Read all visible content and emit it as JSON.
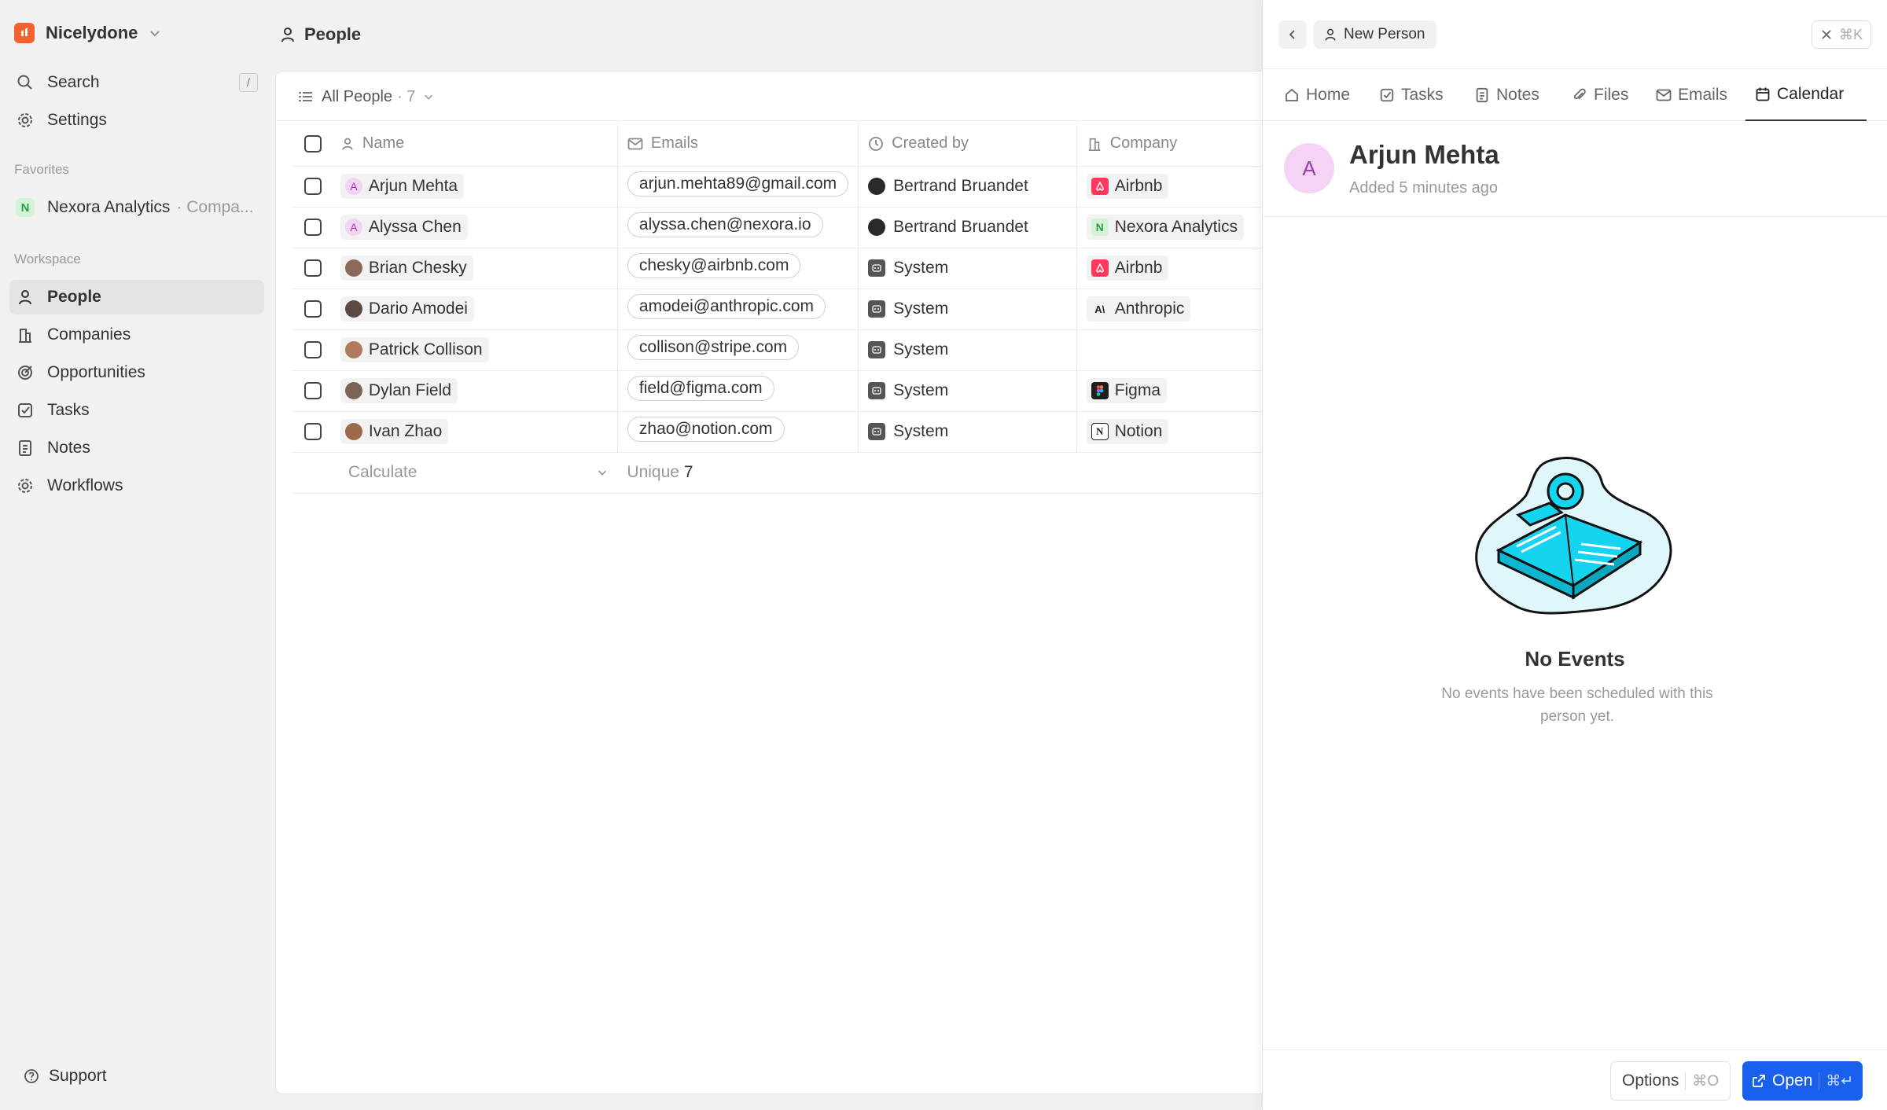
{
  "sidebar": {
    "workspace_name": "Nicelydone",
    "search_label": "Search",
    "search_shortcut": "/",
    "settings_label": "Settings",
    "favorites_heading": "Favorites",
    "favorite": {
      "badge": "N",
      "name": "Nexora Analytics",
      "suffix": "· Compa..."
    },
    "workspace_heading": "Workspace",
    "nav": [
      "People",
      "Companies",
      "Opportunities",
      "Tasks",
      "Notes",
      "Workflows"
    ],
    "active_nav": "People",
    "support_label": "Support"
  },
  "header": {
    "title": "People"
  },
  "view": {
    "name": "All People",
    "count": "· 7"
  },
  "table": {
    "columns": [
      "Name",
      "Emails",
      "Created by",
      "Company"
    ],
    "rows": [
      {
        "name": "Arjun Mehta",
        "email": "arjun.mehta89@gmail.com",
        "created_by": "Bertrand Bruandet",
        "company": "Airbnb"
      },
      {
        "name": "Alyssa Chen",
        "email": "alyssa.chen@nexora.io",
        "created_by": "Bertrand Bruandet",
        "company": "Nexora Analytics"
      },
      {
        "name": "Brian Chesky",
        "email": "chesky@airbnb.com",
        "created_by": "System",
        "company": "Airbnb"
      },
      {
        "name": "Dario Amodei",
        "email": "amodei@anthropic.com",
        "created_by": "System",
        "company": "Anthropic"
      },
      {
        "name": "Patrick Collison",
        "email": "collison@stripe.com",
        "created_by": "System",
        "company": ""
      },
      {
        "name": "Dylan Field",
        "email": "field@figma.com",
        "created_by": "System",
        "company": "Figma"
      },
      {
        "name": "Ivan Zhao",
        "email": "zhao@notion.com",
        "created_by": "System",
        "company": "Notion"
      }
    ],
    "footer": {
      "calculate_label": "Calculate",
      "unique_label": "Unique",
      "unique_value": "7"
    }
  },
  "drawer": {
    "record_type_label": "New Person",
    "close_shortcut": "⌘K",
    "tabs": [
      "Home",
      "Tasks",
      "Notes",
      "Files",
      "Emails",
      "Calendar"
    ],
    "active_tab": "Calendar",
    "person": {
      "initial": "A",
      "name": "Arjun Mehta",
      "added": "Added 5 minutes ago"
    },
    "empty_title": "No Events",
    "empty_text": "No events have been scheduled with this person yet.",
    "options_label": "Options",
    "options_shortcut": "⌘O",
    "open_label": "Open",
    "open_shortcut": "⌘↵"
  },
  "colors": {
    "accent": "#1961ed",
    "brand": "#f2622e",
    "avatar_bg": "#f4d3f4"
  }
}
